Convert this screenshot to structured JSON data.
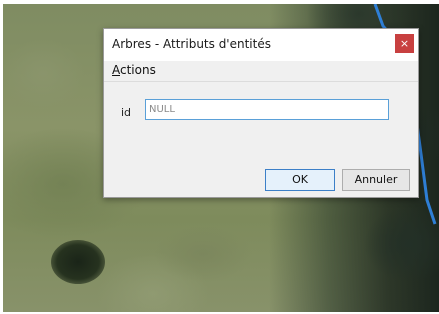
{
  "dialog": {
    "title": "Arbres - Attributs d'entités",
    "close_glyph": "×",
    "menu": {
      "actions_accel": "A",
      "actions_rest": "ctions"
    },
    "field": {
      "label": "id",
      "placeholder": "NULL",
      "value": ""
    },
    "buttons": {
      "ok": "OK",
      "cancel": "Annuler"
    }
  },
  "colors": {
    "close_button": "#c84040",
    "input_focus_border": "#5aa0d8",
    "map_river": "#2f7fd6"
  }
}
